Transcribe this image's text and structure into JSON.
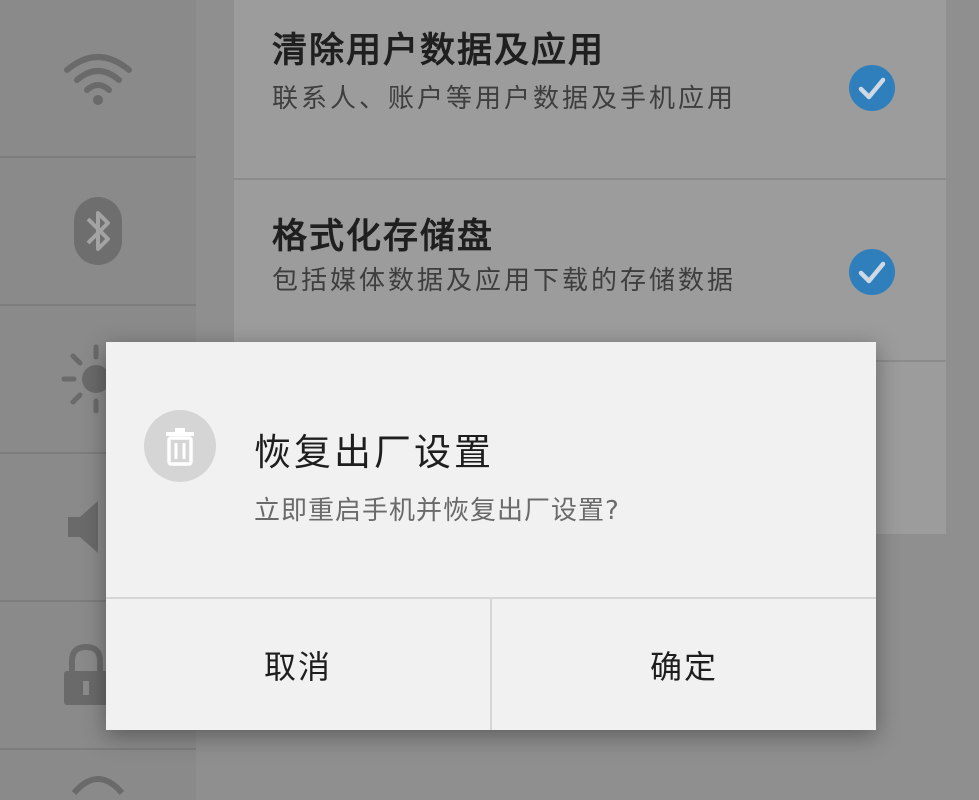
{
  "sidebar": {
    "items": [
      {
        "icon": "wifi-icon"
      },
      {
        "icon": "bluetooth-icon"
      },
      {
        "icon": "brightness-icon"
      },
      {
        "icon": "volume-icon"
      },
      {
        "icon": "lock-icon"
      },
      {
        "icon": "more-icon"
      }
    ]
  },
  "settings": {
    "items": [
      {
        "title": "清除用户数据及应用",
        "description": "联系人、账户等用户数据及手机应用",
        "checked": true
      },
      {
        "title": "格式化存储盘",
        "description": "包括媒体数据及应用下载的存储数据",
        "checked": true
      }
    ]
  },
  "dialog": {
    "icon": "trash-icon",
    "title": "恢复出厂设置",
    "message": "立即重启手机并恢复出厂设置?",
    "cancel_label": "取消",
    "confirm_label": "确定"
  },
  "colors": {
    "check_blue": "#2f7fbd",
    "dialog_bg": "#f1f1f1",
    "overlay_gray": "#8f8f8f"
  }
}
